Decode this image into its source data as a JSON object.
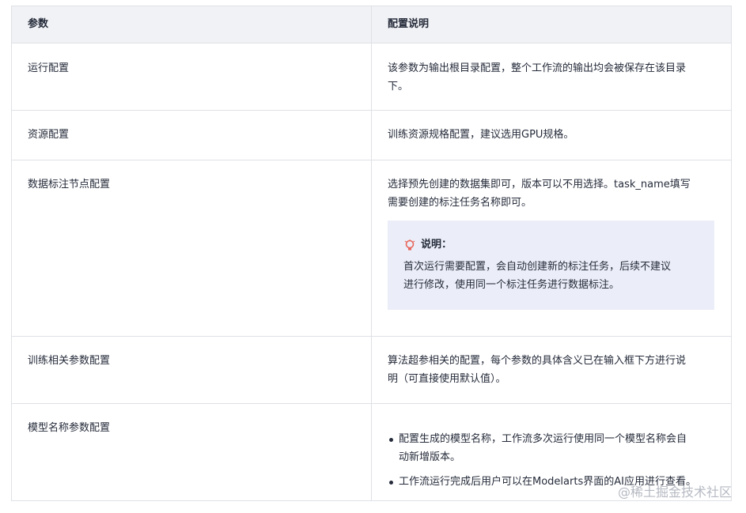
{
  "header": {
    "param": "参数",
    "desc": "配置说明"
  },
  "rows": [
    {
      "param": "运行配置",
      "desc_lines": [
        "该参数为输出根目录配置，整个工作流的输出均会被保存在该目录",
        "下。"
      ]
    },
    {
      "param": "资源配置",
      "desc_lines": [
        "训练资源规格配置，建议选用GPU规格。"
      ]
    },
    {
      "param": "数据标注节点配置",
      "desc_lines": [
        "选择预先创建的数据集即可，版本可以不用选择。task_name填写",
        "需要创建的标注任务名称即可。"
      ],
      "note": {
        "title": "说明：",
        "lines": [
          "首次运行需要配置，会自动创建新的标注任务，后续不建议",
          "进行修改，使用同一个标注任务进行数据标注。"
        ]
      }
    },
    {
      "param": "训练相关参数配置",
      "desc_lines": [
        "算法超参相关的配置，每个参数的具体含义已在输入框下方进行说",
        "明（可直接使用默认值）。"
      ]
    },
    {
      "param": "模型名称参数配置",
      "bullets": [
        {
          "lines": [
            "配置生成的模型名称，工作流多次运行使用同一个模型名称会自",
            "动新增版本。"
          ]
        },
        {
          "lines": [
            "工作流运行完成后用户可以在Modelarts界面的AI应用进行查看。"
          ]
        }
      ]
    }
  ],
  "watermark": "@稀土掘金技术社区",
  "colors": {
    "border": "#dfe1e6",
    "header_bg": "#f1f2f5",
    "note_bg": "#ebeef8",
    "text": "#252b3a",
    "bulb": "#e8665c"
  },
  "icons": {
    "note": "lightbulb-icon"
  }
}
